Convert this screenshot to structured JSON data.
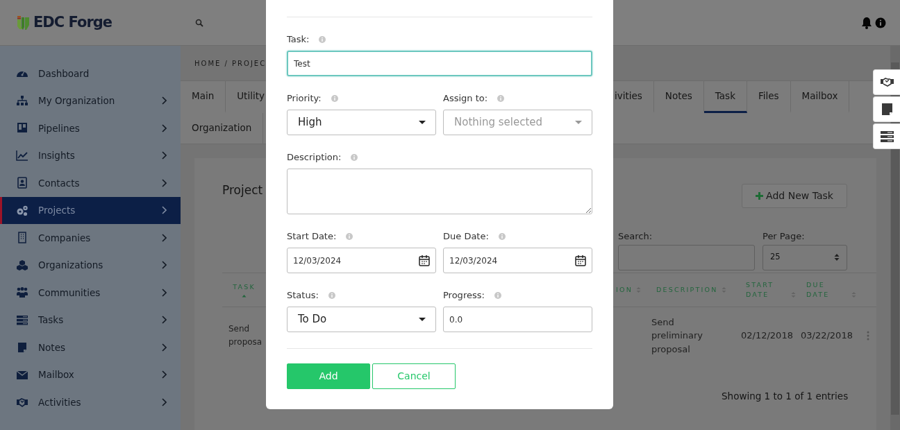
{
  "header": {
    "logo": "EDC Forge"
  },
  "sidebar": {
    "items": [
      {
        "label": "Dashboard",
        "selected": false,
        "expandable": false
      },
      {
        "label": "My Organization",
        "selected": false,
        "expandable": true
      },
      {
        "label": "Pipelines",
        "selected": false,
        "expandable": true
      },
      {
        "label": "Insights",
        "selected": false,
        "expandable": true
      },
      {
        "label": "Contacts",
        "selected": false,
        "expandable": true
      },
      {
        "label": "Projects",
        "selected": true,
        "expandable": true
      },
      {
        "label": "Companies",
        "selected": false,
        "expandable": true
      },
      {
        "label": "Organizations",
        "selected": false,
        "expandable": true
      },
      {
        "label": "Communities",
        "selected": false,
        "expandable": true
      },
      {
        "label": "Tasks",
        "selected": false,
        "expandable": true
      },
      {
        "label": "Notes",
        "selected": false,
        "expandable": true
      },
      {
        "label": "Mailbox",
        "selected": false,
        "expandable": true
      },
      {
        "label": "Activities",
        "selected": false,
        "expandable": true
      }
    ]
  },
  "breadcrumb": "HOME / PROJEC",
  "tab_rows": [
    [
      {
        "label": "Main",
        "selected": false
      },
      {
        "label": "Utility",
        "selected": false
      },
      {
        "label": "ivities",
        "selected": false
      },
      {
        "label": "Notes",
        "selected": false
      },
      {
        "label": "Task",
        "selected": true
      },
      {
        "label": "Files",
        "selected": false
      },
      {
        "label": "Mailbox",
        "selected": false
      }
    ],
    [
      {
        "label": "Organization",
        "selected": false
      }
    ]
  ],
  "panel": {
    "title": "Project",
    "add_button": "Add New Task",
    "search": {
      "label": "Search:"
    },
    "per_page": {
      "label": "Per Page:",
      "value": "25"
    }
  },
  "table": {
    "columns": [
      {
        "label": "TASK",
        "sorted": true
      },
      {
        "label": "ION",
        "sorted": false
      },
      {
        "label": "DESCRIPTION",
        "sorted": false
      },
      {
        "label": "START DATE",
        "sorted": false
      },
      {
        "label": "DUE DATE",
        "sorted": false
      }
    ],
    "rows": [
      {
        "task": "Send proposa",
        "description": "Send preliminary proposal",
        "start_date": "02/12/2018",
        "due_date": "03/22/2018"
      }
    ]
  },
  "footer": "Showing 1 to 1 of 1 entries",
  "modal": {
    "rows": [
      [
        {
          "label": "Task:",
          "kind": "text",
          "value": "Test",
          "focused": true
        }
      ],
      [
        {
          "label": "Priority:",
          "kind": "select",
          "value": "High"
        },
        {
          "label": "Assign to:",
          "kind": "select",
          "placeholder": "Nothing selected"
        }
      ],
      [
        {
          "label": "Description:",
          "kind": "textarea"
        }
      ],
      [
        {
          "label": "Start Date:",
          "kind": "date",
          "value": "12/03/2024"
        },
        {
          "label": "Due Date:",
          "kind": "date",
          "value": "12/03/2024"
        }
      ],
      [
        {
          "label": "Status:",
          "kind": "select",
          "value": "To Do"
        },
        {
          "label": "Progress:",
          "kind": "text",
          "value": "0.0"
        }
      ]
    ],
    "buttons": [
      {
        "label": "Add",
        "kind": "primary"
      },
      {
        "label": "Cancel",
        "kind": "outline"
      }
    ]
  }
}
